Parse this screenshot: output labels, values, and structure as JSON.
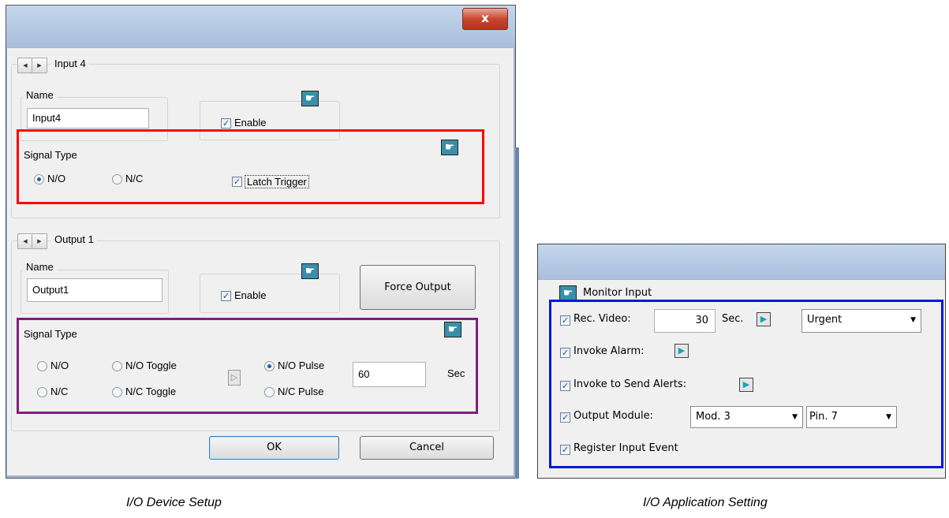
{
  "device_setup": {
    "close_glyph": "x",
    "input": {
      "header": "Input 4",
      "name_label": "Name",
      "name_value": "Input4",
      "enable_label": "Enable",
      "signal_type_label": "Signal Type",
      "no_label": "N/O",
      "nc_label": "N/C",
      "latch_label": "Latch Trigger"
    },
    "output": {
      "header": "Output 1",
      "name_label": "Name",
      "name_value": "Output1",
      "enable_label": "Enable",
      "force_label": "Force Output",
      "signal_type_label": "Signal Type",
      "no_label": "N/O",
      "nc_label": "N/C",
      "no_toggle_label": "N/O Toggle",
      "nc_toggle_label": "N/C Toggle",
      "no_pulse_label": "N/O Pulse",
      "nc_pulse_label": "N/C Pulse",
      "pulse_value": "60",
      "pulse_unit": "Sec"
    },
    "ok_label": "OK",
    "cancel_label": "Cancel"
  },
  "app_setting": {
    "group_label": "Monitor Input",
    "rec_video_label": "Rec. Video:",
    "rec_video_value": "30",
    "rec_video_unit": "Sec.",
    "priority_value": "Urgent",
    "invoke_alarm_label": "Invoke Alarm:",
    "send_alerts_label": "Invoke to Send Alerts:",
    "output_module_label": "Output Module:",
    "module_value": "Mod. 3",
    "pin_value": "Pin. 7",
    "register_label": "Register Input Event"
  },
  "captions": {
    "left": "I/O Device Setup",
    "right": "I/O Application Setting"
  },
  "colors": {
    "highlight_signal_input": "#ff0000",
    "highlight_signal_output": "#7f1f7f",
    "highlight_monitor": "#0019d9"
  },
  "icons": {
    "hand": "pointing-hand-icon",
    "arrow": "play-arrow-icon",
    "check": "check-icon"
  }
}
